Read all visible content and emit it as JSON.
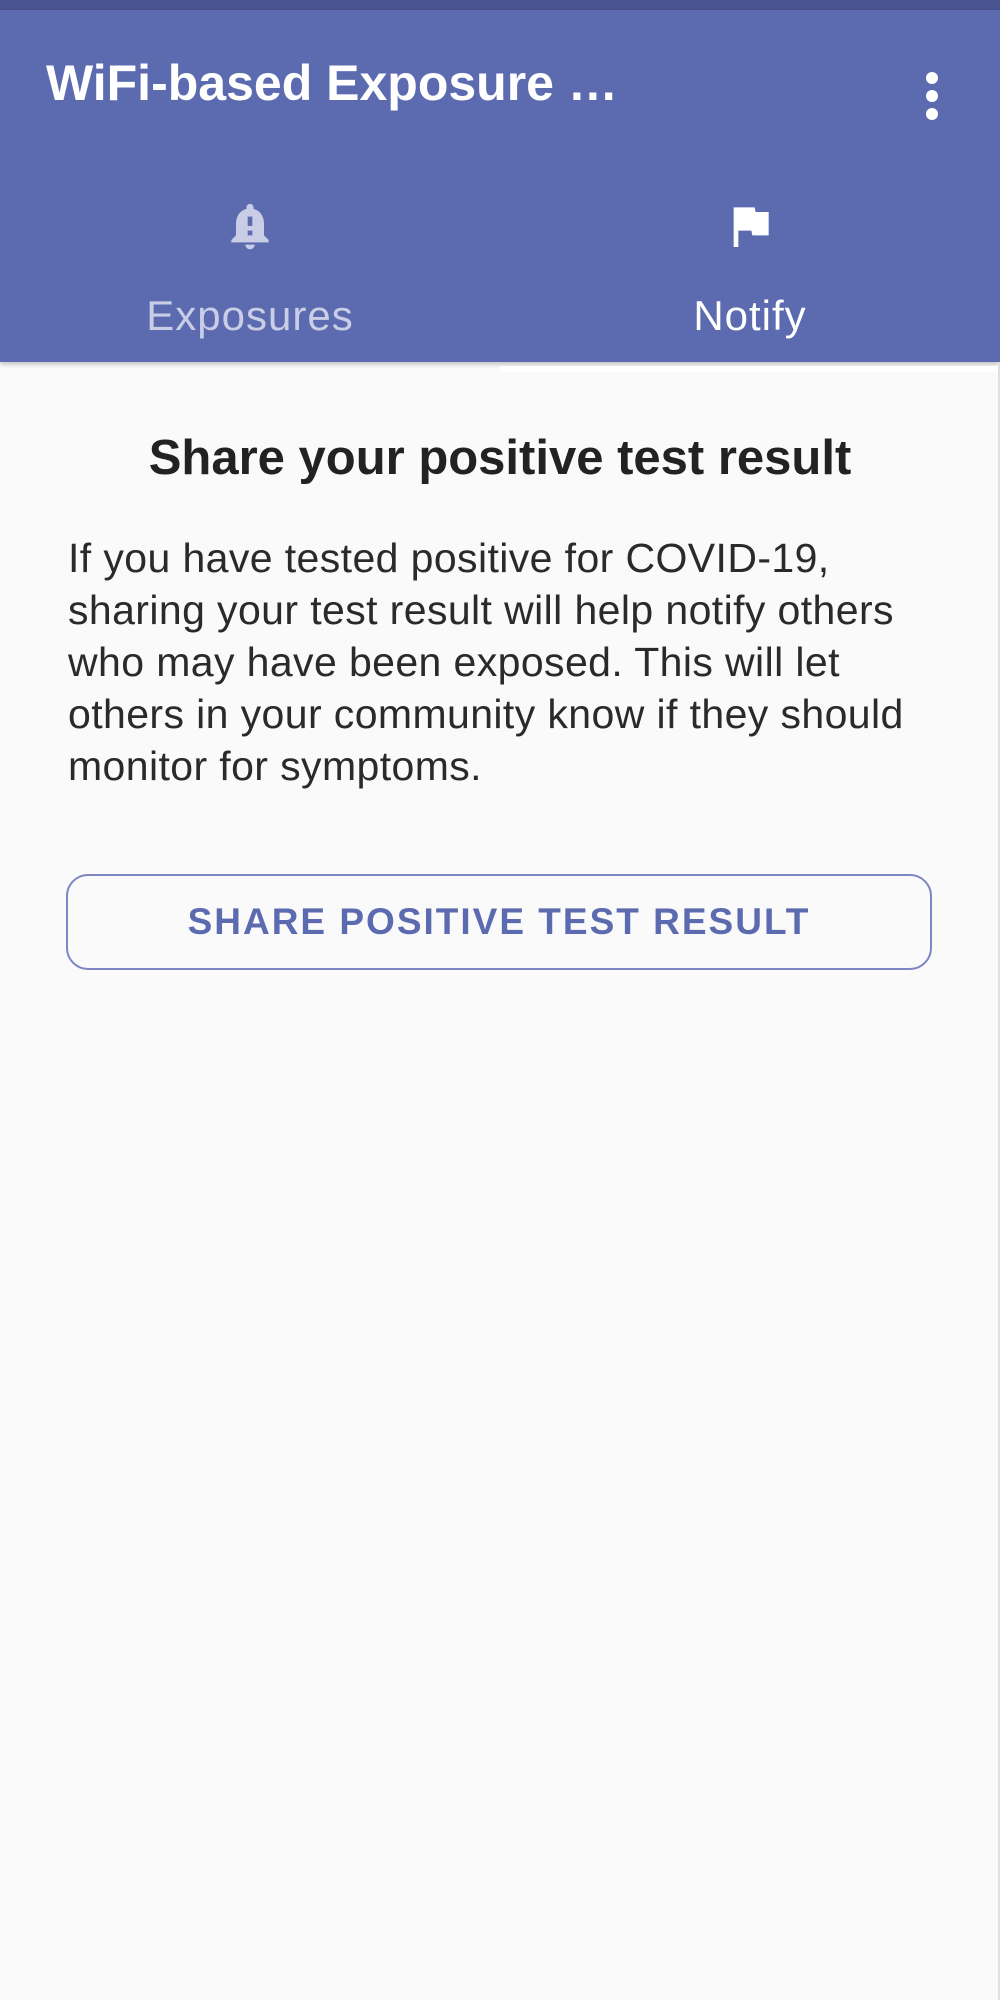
{
  "app_bar": {
    "title": "WiFi-based Exposure …",
    "overflow_icon": "more-vertical-icon"
  },
  "tabs": [
    {
      "label": "Exposures",
      "icon": "alert-bell-icon",
      "selected": false
    },
    {
      "label": "Notify",
      "icon": "flag-icon",
      "selected": true
    }
  ],
  "main": {
    "heading": "Share your positive test result",
    "body": "If you have tested positive for COVID-19, sharing your test result will help notify others who may have been exposed. This will let others in your community know if they should monitor for symptoms.",
    "share_button_label": "SHARE POSITIVE TEST RESULT"
  },
  "colors": {
    "primary": "#5c6bb0",
    "primary_dark": "#4a5391",
    "background": "#fafafa",
    "button_outline": "#7d86c2"
  }
}
